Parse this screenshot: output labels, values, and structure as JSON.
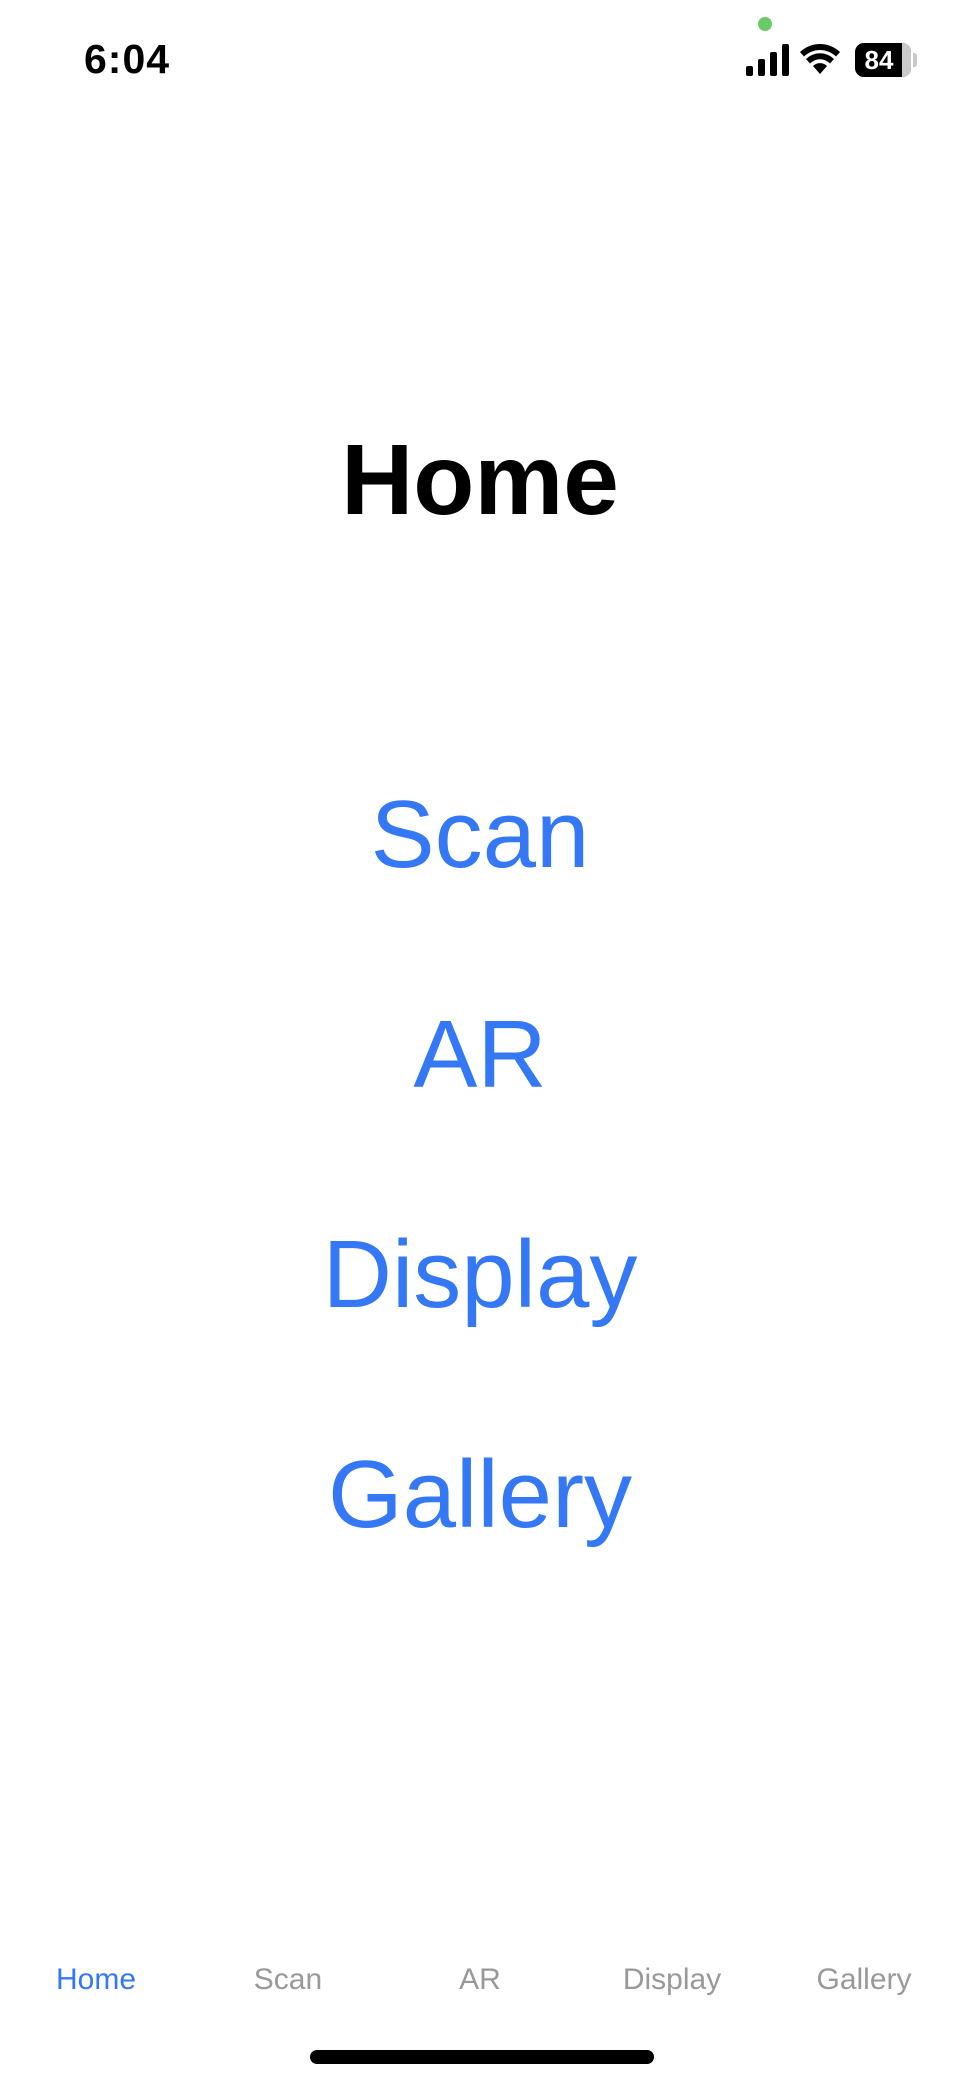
{
  "status_bar": {
    "time": "6:04",
    "battery_level": "84",
    "icons": [
      "privacy-indicator-dot",
      "cellular-signal-icon",
      "wifi-icon",
      "battery-icon"
    ]
  },
  "page": {
    "title": "Home"
  },
  "menu": {
    "items": [
      {
        "label": "Scan"
      },
      {
        "label": "AR"
      },
      {
        "label": "Display"
      },
      {
        "label": "Gallery"
      }
    ]
  },
  "tab_bar": {
    "active_index": 0,
    "tabs": [
      {
        "label": "Home"
      },
      {
        "label": "Scan"
      },
      {
        "label": "AR"
      },
      {
        "label": "Display"
      },
      {
        "label": "Gallery"
      }
    ]
  },
  "colors": {
    "accent": "#3478f6",
    "inactive_tab": "#999999",
    "privacy_dot": "#6cc96a",
    "text": "#000000",
    "background": "#ffffff"
  }
}
